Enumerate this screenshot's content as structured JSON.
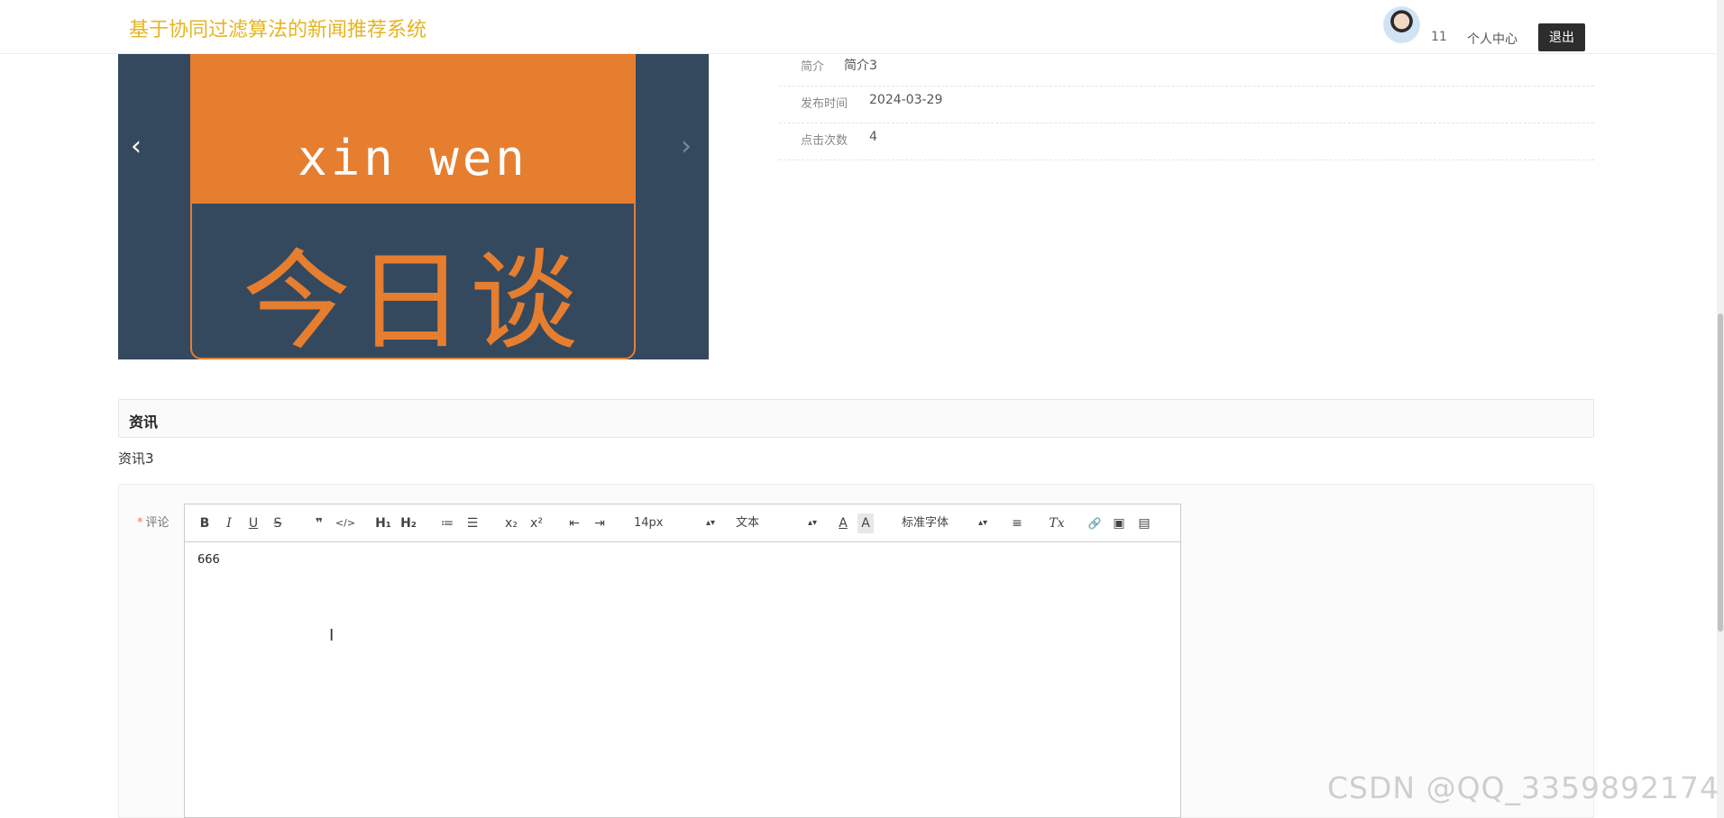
{
  "header": {
    "site_title": "基于协同过滤算法的新闻推荐系统",
    "user_name": "11",
    "personal_center": "个人中心",
    "logout": "退出"
  },
  "carousel": {
    "pinyin": "xin wen",
    "main_text": "今日谈",
    "prev_icon": "‹",
    "next_icon": "›"
  },
  "info": [
    {
      "label": "简介",
      "value": "简介3"
    },
    {
      "label": "发布时间",
      "value": "2024-03-29"
    },
    {
      "label": "点击次数",
      "value": "4"
    }
  ],
  "section": {
    "title": "资讯",
    "body": "资讯3"
  },
  "comment": {
    "required_mark": "*",
    "label": "评论",
    "content": "666"
  },
  "toolbar": {
    "bold": "B",
    "italic": "I",
    "underline": "U",
    "strike": "S",
    "blockquote": "❞",
    "code": "</>",
    "h1": "H₁",
    "h2": "H₂",
    "ordered_list": "≔",
    "bullet_list": "☰",
    "subscript": "x₂",
    "superscript": "x²",
    "outdent": "⇤",
    "indent": "⇥",
    "size": "14px",
    "header_select": "文本",
    "color": "A",
    "background": "A",
    "font": "标准字体",
    "align": "≡",
    "clean": "Tx",
    "link": "🔗",
    "image": "▣",
    "video": "▤"
  },
  "watermark": "CSDN @QQ_3359892174"
}
